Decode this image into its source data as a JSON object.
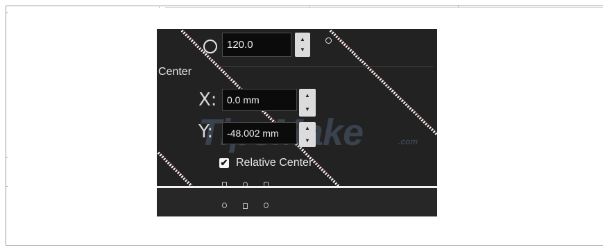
{
  "rotation": {
    "value": "120.0",
    "degree_symbol": "o"
  },
  "center": {
    "section_label": "Center",
    "x": {
      "axis_label": "X:",
      "value": "0.0 mm"
    },
    "y": {
      "axis_label": "Y:",
      "value": "-48.002 mm"
    }
  },
  "relative_center": {
    "label": "Relative Center",
    "checked": true,
    "check_glyph": "✔"
  },
  "watermark": {
    "text": "TipsMake",
    "suffix": ".com"
  },
  "icons": {
    "rotation": "circle-icon",
    "degree": "degree-icon",
    "spinner_up": "▲",
    "spinner_down": "▼"
  }
}
